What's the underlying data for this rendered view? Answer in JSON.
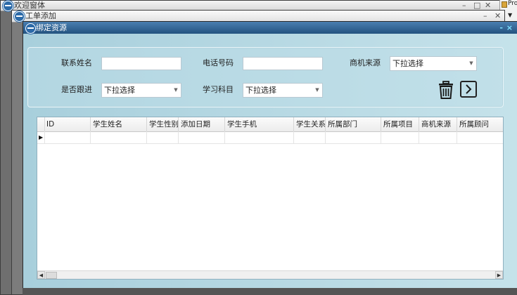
{
  "windows": {
    "back": {
      "title": "欢迎窗体"
    },
    "middle": {
      "title": "工单添加"
    },
    "main": {
      "title": "绑定资源",
      "minimize": "-",
      "close": "×"
    }
  },
  "controls": {
    "minimize": "–",
    "maximize": "□",
    "close": "✕",
    "scroll_down": "▼"
  },
  "side_panel": {
    "label": "Proje"
  },
  "filters": {
    "contact_name": {
      "label": "联系姓名",
      "value": ""
    },
    "phone": {
      "label": "电话号码",
      "value": ""
    },
    "lead_source": {
      "label": "商机来源",
      "value": "下拉选择"
    },
    "follow_up": {
      "label": "是否跟进",
      "value": "下拉选择"
    },
    "subject": {
      "label": "学习科目",
      "value": "下拉选择"
    }
  },
  "grid": {
    "columns": [
      "ID",
      "学生姓名",
      "学生性别",
      "添加日期",
      "学生手机",
      "学生关系",
      "所属部门",
      "所属项目",
      "商机来源",
      "所属顾问"
    ],
    "row_indicator": "▶"
  },
  "scroll": {
    "left": "◀",
    "right": "▶"
  },
  "icons": {
    "delete": "trash-icon",
    "next": "chevron-right-icon",
    "app": "app-icon"
  }
}
